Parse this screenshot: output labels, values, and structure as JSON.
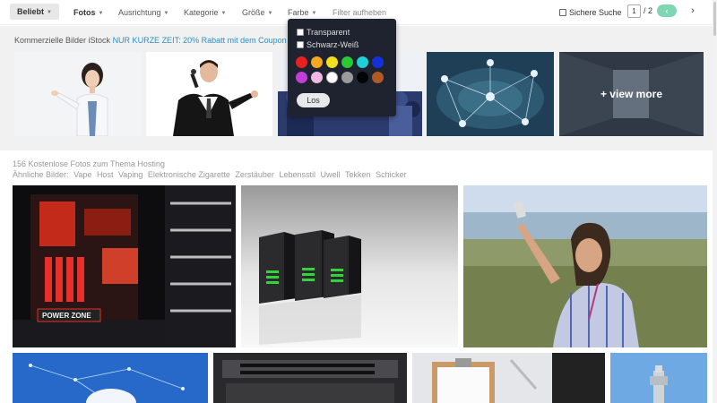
{
  "toolbar": {
    "beliebt": "Beliebt",
    "fotos": "Fotos",
    "ausrichtung": "Ausrichtung",
    "kategorie": "Kategorie",
    "groesse": "Größe",
    "farbe": "Farbe",
    "filter_aufheben": "Filter aufheben",
    "sichere_suche": "Sichere Suche",
    "page_current": "1",
    "page_total": "/ 2",
    "prev": "‹",
    "next": "›"
  },
  "istock": {
    "label": "Kommerzielle Bilder iStock",
    "promo": "NUR KURZE ZEIT: 20% Rabatt mit dem Coupon",
    "view_more": "+ view more"
  },
  "results": {
    "count_line": "156 Kostenlose Fotos zum Thema Hosting",
    "similar_label": "Ähnliche Bilder:",
    "similar_tags": [
      "Vape",
      "Host",
      "Vaping",
      "Elektronische Zigarette",
      "Zerstäuber",
      "Lebensstil",
      "Uwell",
      "Tekken",
      "Schicker"
    ]
  },
  "photo_texts": {
    "power_zone": "POWER ZONE"
  },
  "farbe_panel": {
    "transparent": "Transparent",
    "schwarz_weiss": "Schwarz-Weiß",
    "los": "Los",
    "colors": [
      "#e8201f",
      "#f5a623",
      "#f3e01c",
      "#29c934",
      "#1fd0d6",
      "#1430d8",
      "#c13ed8",
      "#f2b7e3",
      "#ffffff",
      "#9b9b9b",
      "#050505",
      "#b15a25"
    ]
  }
}
